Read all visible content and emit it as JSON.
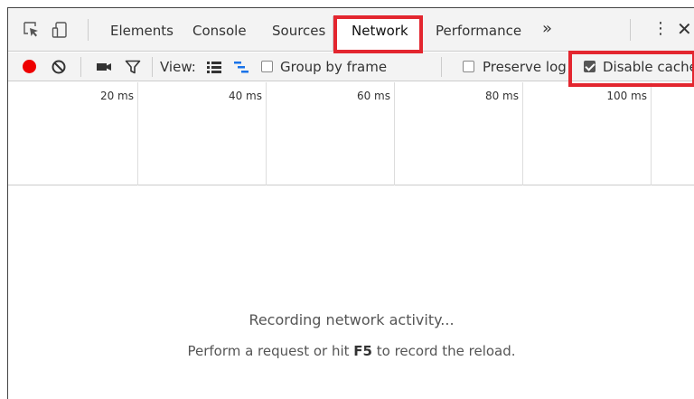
{
  "tabbar": {
    "tabs": [
      {
        "label": "Elements"
      },
      {
        "label": "Console"
      },
      {
        "label": "Sources"
      },
      {
        "label": "Network",
        "active": true
      },
      {
        "label": "Performance"
      }
    ],
    "overflow_glyph": "»",
    "menu_glyph": "⋮",
    "close_glyph": "✕",
    "icons": [
      "inspect-element-icon",
      "device-toolbar-icon"
    ]
  },
  "toolbar": {
    "view_label": "View:",
    "group_by_frame_label": "Group by frame",
    "group_by_frame_checked": false,
    "preserve_log_label": "Preserve log",
    "preserve_log_checked": false,
    "disable_cache_label": "Disable cache",
    "disable_cache_checked": true,
    "icons": [
      "record-icon",
      "clear-icon",
      "screenshot-icon",
      "filter-icon",
      "list-view-icon",
      "waterfall-view-icon"
    ],
    "record_color": "#e00000"
  },
  "timeline": {
    "ticks": [
      "20 ms",
      "40 ms",
      "60 ms",
      "80 ms",
      "100 ms"
    ]
  },
  "empty_state": {
    "main": "Recording network activity...",
    "sub_before": "Perform a request or hit ",
    "sub_key": "F5",
    "sub_after": " to record the reload."
  },
  "highlight_color": "#e3262f"
}
